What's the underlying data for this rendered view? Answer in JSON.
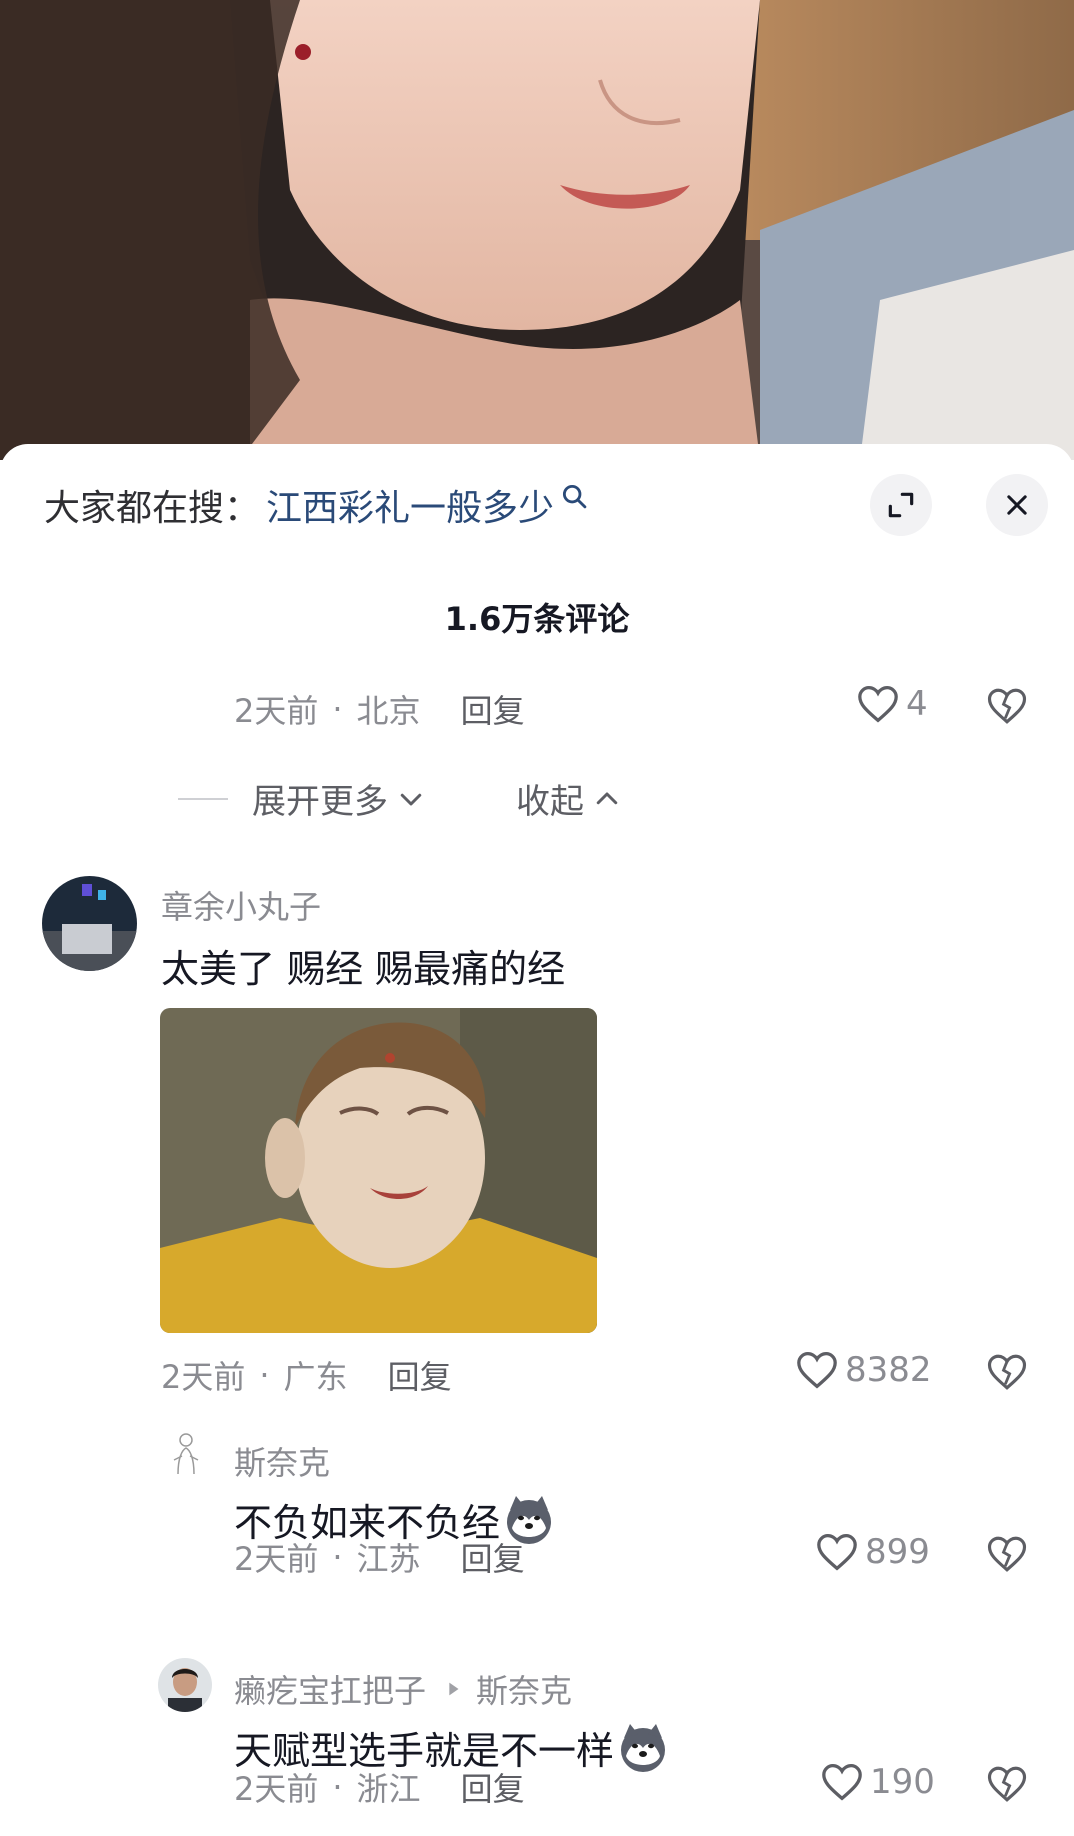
{
  "search": {
    "prefix": "大家都在搜：",
    "keyword": "江西彩礼一般多少"
  },
  "header": {
    "comment_count": "1.6万条评论"
  },
  "icons": {
    "expand": "expand-icon",
    "close": "close-icon",
    "like": "heart-icon",
    "dislike": "broken-heart-icon",
    "search": "search-icon"
  },
  "colors": {
    "keyword": "#2a4a78",
    "meta_text": "#8a8b91",
    "primary_text": "#161823"
  },
  "prev_reply": {
    "time": "2天前",
    "location": "北京",
    "reply_label": "回复",
    "likes": "4"
  },
  "thread_controls": {
    "expand_more": "展开更多",
    "collapse": "收起"
  },
  "comments": [
    {
      "username": "章余小丸子",
      "text": "太美了 赐经 赐最痛的经",
      "time": "2天前",
      "location": "广东",
      "reply_label": "回复",
      "likes": "8382"
    }
  ],
  "replies": [
    {
      "username": "斯奈克",
      "text": "不负如来不负经",
      "emoji": "husky-emoji",
      "time": "2天前",
      "location": "江苏",
      "reply_label": "回复",
      "likes": "899"
    },
    {
      "username": "癞疙宝扛把子",
      "reply_to": "斯奈克",
      "text": "天赋型选手就是不一样",
      "emoji": "husky-emoji",
      "time": "2天前",
      "location": "浙江",
      "reply_label": "回复",
      "likes": "190"
    }
  ]
}
